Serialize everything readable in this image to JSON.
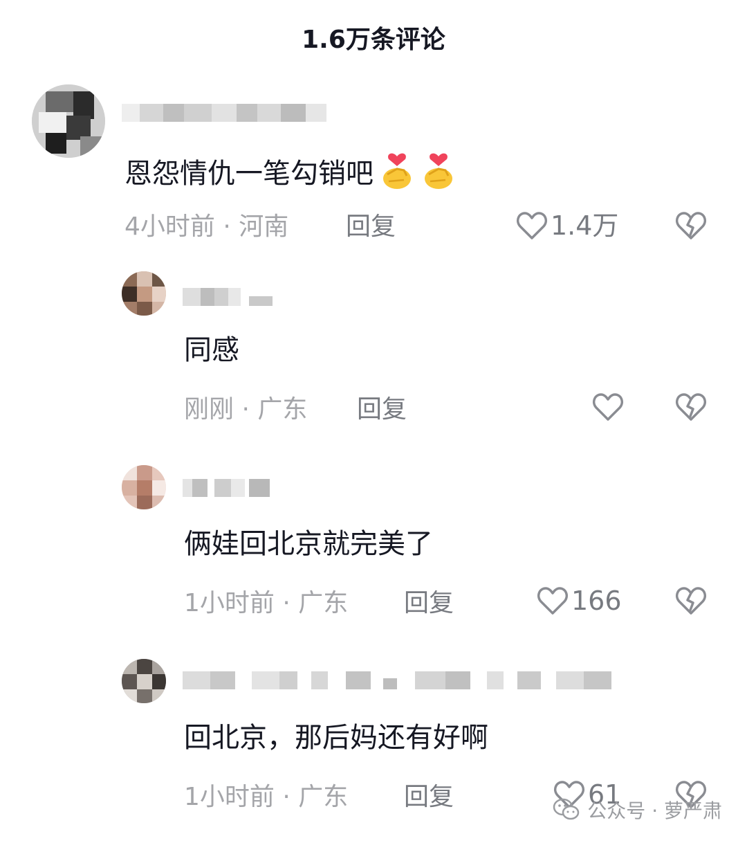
{
  "header": {
    "title": "1.6万条评论"
  },
  "comments": [
    {
      "content": "恩怨情仇一笔勾销吧",
      "emoji": [
        "finger-heart-emoji",
        "finger-heart-emoji"
      ],
      "time": "4小时前",
      "location": "河南",
      "reply_label": "回复",
      "likes": "1.4万"
    },
    {
      "content": "同感",
      "time": "刚刚",
      "location": "广东",
      "reply_label": "回复",
      "likes": ""
    },
    {
      "content": "俩娃回北京就完美了",
      "time": "1小时前",
      "location": "广东",
      "reply_label": "回复",
      "likes": "166"
    },
    {
      "content": "回北京，那后妈还有好啊",
      "time": "1小时前",
      "location": "广东",
      "reply_label": "回复",
      "likes": "61"
    }
  ],
  "separator": " · ",
  "watermark": {
    "text": "公众号 · 萝严肃",
    "icon": "wechat-icon"
  },
  "colors": {
    "primary_text": "#161823",
    "secondary_text": "#a4a5a9",
    "action_text": "#777a80",
    "icon_stroke": "#8a8c92"
  }
}
